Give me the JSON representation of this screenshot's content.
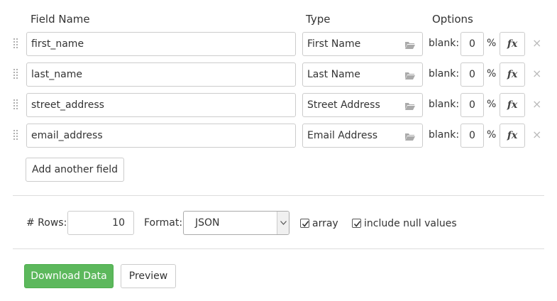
{
  "headers": {
    "field_name": "Field Name",
    "type": "Type",
    "options": "Options"
  },
  "fields": [
    {
      "name": "first_name",
      "type": "First Name",
      "blank_label": "blank:",
      "blank_value": "0",
      "percent": "%",
      "fx": "fx",
      "remove": "×"
    },
    {
      "name": "last_name",
      "type": "Last Name",
      "blank_label": "blank:",
      "blank_value": "0",
      "percent": "%",
      "fx": "fx",
      "remove": "×"
    },
    {
      "name": "street_address",
      "type": "Street Address",
      "blank_label": "blank:",
      "blank_value": "0",
      "percent": "%",
      "fx": "fx",
      "remove": "×"
    },
    {
      "name": "email_address",
      "type": "Email Address",
      "blank_label": "blank:",
      "blank_value": "0",
      "percent": "%",
      "fx": "fx",
      "remove": "×"
    }
  ],
  "add_field_label": "Add another field",
  "settings": {
    "rows_label": "# Rows:",
    "rows_value": "10",
    "format_label": "Format:",
    "format_value": "JSON",
    "array_label": "array",
    "array_checked": true,
    "null_label": "include null values",
    "null_checked": true
  },
  "actions": {
    "download_label": "Download Data",
    "preview_label": "Preview"
  },
  "colors": {
    "primary_green": "#5cb85c",
    "border": "#cccccc",
    "divider": "#dddddd"
  },
  "icons": {
    "drag": "drag-handle-icon",
    "folder": "folder-icon",
    "remove": "close-icon",
    "dropdown": "chevron-down-icon",
    "check": "checkmark-icon"
  }
}
